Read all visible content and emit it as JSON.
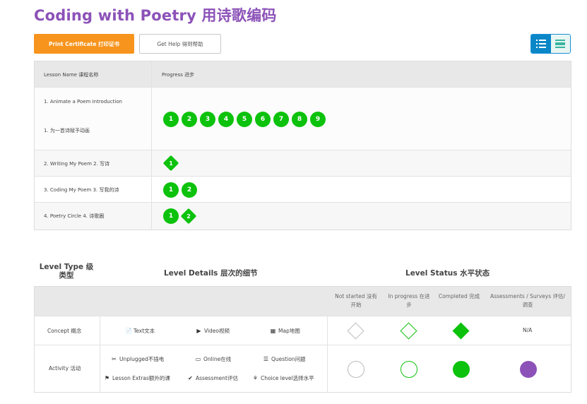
{
  "page": {
    "title": "Coding with Poetry 用诗歌编码"
  },
  "toolbar": {
    "print_label": "Print Certificate 打印证书",
    "help_label": "Get Help 得到帮助",
    "view_list_icon": "list-icon",
    "view_detail_icon": "detail-view-icon"
  },
  "progress_table": {
    "headers": {
      "lesson": "Lesson Name 课程名称",
      "progress": "Progress 进步"
    },
    "rows": [
      {
        "name_line1": "1. Animate a Poem Introduction",
        "name_line2": "1. 为一首诗赋予动画",
        "items": [
          {
            "type": "bubble",
            "label": "1"
          },
          {
            "type": "bubble",
            "label": "2"
          },
          {
            "type": "bubble",
            "label": "3"
          },
          {
            "type": "bubble",
            "label": "4"
          },
          {
            "type": "bubble",
            "label": "5"
          },
          {
            "type": "bubble",
            "label": "6"
          },
          {
            "type": "bubble",
            "label": "7"
          },
          {
            "type": "bubble",
            "label": "8"
          },
          {
            "type": "bubble",
            "label": "9"
          }
        ]
      },
      {
        "name_line1": "2. Writing My Poem 2. 写诗",
        "items": [
          {
            "type": "diamond",
            "label": "1"
          }
        ]
      },
      {
        "name_line1": "3. Coding My Poem 3. 写我的诗",
        "items": [
          {
            "type": "bubble",
            "label": "1"
          },
          {
            "type": "bubble",
            "label": "2"
          }
        ]
      },
      {
        "name_line1": "4. Poetry Circle 4. 诗歌圈",
        "items": [
          {
            "type": "bubble",
            "label": "1"
          },
          {
            "type": "diamond",
            "label": "2"
          }
        ]
      }
    ]
  },
  "legend": {
    "level_type_heading": "Level Type 级类型",
    "level_details_heading": "Level Details 层次的细节",
    "level_status_heading": "Level Status 水平状态",
    "status_columns": {
      "not_started": "Not started 没有开始",
      "in_progress": "In progress 在进步",
      "completed": "Completed 完成",
      "assessments": "Assessments / Surveys 评估/调查"
    },
    "concept": {
      "label": "Concept 概念",
      "details": [
        {
          "icon": "document-icon",
          "text": "Text文本"
        },
        {
          "icon": "video-icon",
          "text": "Video视频"
        },
        {
          "icon": "map-icon",
          "text": "Map地图"
        }
      ],
      "assessment_value": "N/A"
    },
    "activity": {
      "label": "Activity 活动",
      "details": [
        {
          "icon": "scissors-icon",
          "text": "Unplugged不插电"
        },
        {
          "icon": "monitor-icon",
          "text": "Online在线"
        },
        {
          "icon": "list-icon",
          "text": "Question问题"
        },
        {
          "icon": "flag-icon",
          "text": "Lesson Extras额外的课"
        },
        {
          "icon": "check-circle-icon",
          "text": "Assessment评估"
        },
        {
          "icon": "sitemap-icon",
          "text": "Choice level选择水平"
        }
      ]
    }
  },
  "colors": {
    "title": "#8c52b8",
    "accent_orange": "#f7941d",
    "complete_green": "#0cc20c",
    "assessment_purple": "#8c52b8",
    "toggle_blue": "#0b87c7"
  }
}
